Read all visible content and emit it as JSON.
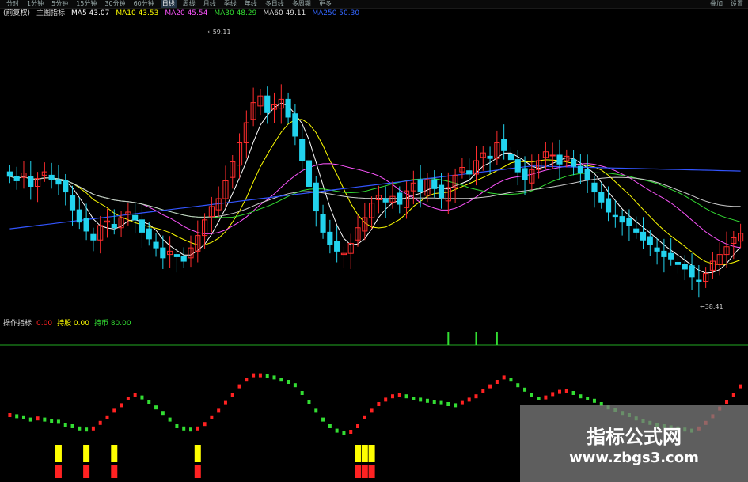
{
  "toolbar": {
    "tabs": [
      "分时",
      "1分钟",
      "5分钟",
      "15分钟",
      "30分钟",
      "60分钟",
      "日线",
      "周线",
      "月线",
      "季线",
      "年线",
      "多日线",
      "多周期",
      "更多"
    ],
    "active_tab": "日线",
    "right_items": [
      "叠加",
      "设置"
    ]
  },
  "legend": {
    "title": "(前复权)",
    "label": "主图指标",
    "items": [
      {
        "key": "ma5",
        "text": "MA5 43.07"
      },
      {
        "key": "ma10",
        "text": "MA10 43.53"
      },
      {
        "key": "ma20",
        "text": "MA20 45.54"
      },
      {
        "key": "ma30",
        "text": "MA30 48.29"
      },
      {
        "key": "ma60",
        "text": "MA60 49.11"
      },
      {
        "key": "ma250",
        "text": "MA250 50.30"
      }
    ]
  },
  "indicator_legend": {
    "name": "操作指标",
    "items": [
      {
        "text": "0.00",
        "color": "#ff2222"
      },
      {
        "text": "持股 0.00",
        "color": "#ffff00"
      },
      {
        "text": "持币 80.00",
        "color": "#33dd33"
      }
    ]
  },
  "annotations": {
    "high": "59.11",
    "low": "38.41"
  },
  "watermark": {
    "title": "指标公式网",
    "url": "www.zbgs3.com"
  },
  "colors": {
    "up": "#ff2d2d",
    "down": "#22d3ee",
    "ma5": "#ffffff",
    "ma10": "#ffff00",
    "ma20": "#ff55ff",
    "ma30": "#33dd33",
    "ma60": "#cccccc",
    "ma250": "#3355ff",
    "osc_up": "#ff2222",
    "osc_down": "#33dd33",
    "signal": "#ffff00"
  },
  "chart_data": [
    {
      "type": "candlestick",
      "title": "",
      "xlabel": "",
      "ylabel": "",
      "ylim": [
        36,
        62
      ],
      "max_label": "59.11",
      "min_label": "38.41",
      "closes": [
        48.2,
        47.8,
        48.5,
        47.3,
        48.0,
        48.6,
        47.9,
        47.5,
        46.8,
        45.2,
        44.1,
        43.3,
        42.5,
        43.8,
        44.2,
        43.6,
        44.5,
        45.0,
        44.3,
        43.2,
        42.6,
        41.8,
        40.9,
        41.5,
        41.0,
        40.6,
        41.8,
        42.9,
        44.3,
        45.5,
        46.2,
        47.8,
        49.5,
        51.2,
        53.0,
        54.8,
        55.4,
        53.9,
        54.6,
        55.1,
        53.5,
        51.8,
        49.6,
        47.3,
        45.1,
        43.2,
        42.1,
        41.5,
        41.3,
        42.2,
        43.6,
        44.5,
        45.8,
        46.5,
        45.9,
        46.4,
        45.7,
        46.9,
        47.6,
        46.8,
        47.9,
        47.1,
        46.3,
        47.2,
        48.3,
        49.0,
        48.4,
        49.6,
        50.3,
        49.8,
        51.2,
        50.5,
        49.7,
        48.6,
        47.9,
        48.8,
        49.6,
        50.4,
        50.1,
        49.3,
        50.0,
        49.1,
        48.5,
        47.9,
        46.8,
        45.9,
        45.0,
        44.6,
        44.1,
        43.8,
        43.2,
        42.5,
        42.1,
        41.5,
        41.0,
        40.8,
        40.3,
        39.9,
        39.2,
        38.8,
        39.5,
        40.6,
        41.2,
        41.9,
        42.7,
        43.1
      ],
      "series": [
        {
          "name": "MA5",
          "values_key": "ma5"
        },
        {
          "name": "MA10",
          "values_key": "ma10"
        },
        {
          "name": "MA20",
          "values_key": "ma20"
        },
        {
          "name": "MA30",
          "values_key": "ma30"
        },
        {
          "name": "MA60",
          "values_key": "ma60"
        },
        {
          "name": "MA250",
          "values_key": "ma250"
        }
      ]
    },
    {
      "type": "oscillator",
      "title": "操作指标",
      "ylim": [
        0,
        100
      ],
      "values": [
        40,
        39,
        38,
        36,
        37,
        36,
        35,
        34,
        31,
        30,
        28,
        27,
        28,
        33,
        38,
        44,
        49,
        55,
        58,
        56,
        52,
        47,
        42,
        36,
        30,
        28,
        27,
        28,
        32,
        38,
        44,
        51,
        58,
        66,
        72,
        76,
        76,
        75,
        74,
        72,
        70,
        67,
        60,
        52,
        44,
        36,
        30,
        26,
        24,
        25,
        30,
        38,
        44,
        50,
        54,
        57,
        58,
        57,
        55,
        54,
        53,
        52,
        51,
        50,
        49,
        51,
        54,
        57,
        62,
        66,
        70,
        74,
        72,
        67,
        63,
        58,
        55,
        56,
        59,
        61,
        62,
        60,
        57,
        55,
        53,
        50,
        47,
        45,
        42,
        40,
        37,
        35,
        33,
        31,
        30,
        29,
        28,
        27,
        26,
        28,
        33,
        39,
        46,
        52,
        58,
        66
      ],
      "signals": [
        7,
        11,
        15,
        27,
        50,
        51,
        52
      ]
    }
  ]
}
